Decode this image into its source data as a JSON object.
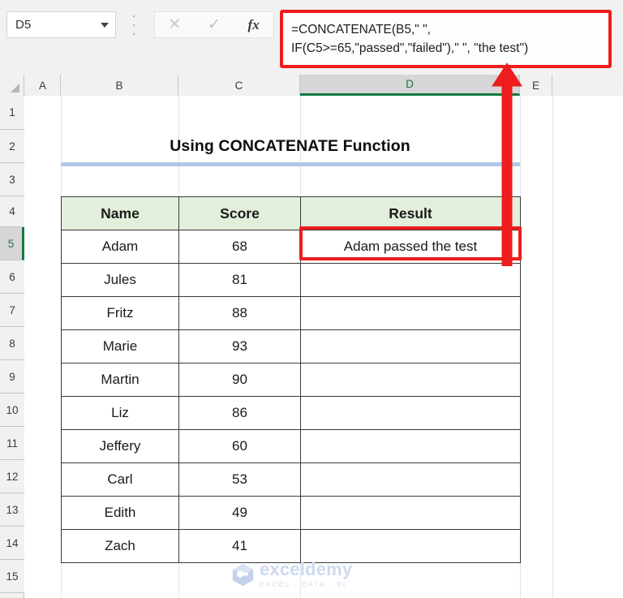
{
  "formula_bar": {
    "name_box_value": "D5",
    "cancel_icon": "close-x-icon",
    "enter_icon": "checkmark-icon",
    "insert_function_icon": "fx-icon",
    "formula_line1": "=CONCATENATE(B5,\" \",",
    "formula_line2": "IF(C5>=65,\"passed\",\"failed\"),\" \", \"the test\")",
    "highlight_color": "#ee1c1c"
  },
  "grid": {
    "column_headers": [
      "A",
      "B",
      "C",
      "D",
      "E"
    ],
    "active_column": "D",
    "row_headers": [
      "1",
      "2",
      "3",
      "4",
      "5",
      "6",
      "7",
      "8",
      "9",
      "10",
      "11",
      "12",
      "13",
      "14",
      "15"
    ],
    "active_row": "5",
    "active_cell": "D5",
    "active_color": "#107c41"
  },
  "report": {
    "title": "Using CONCATENATE Function",
    "title_rule_color": "#b0c7e8",
    "header_fill": "#e2efda",
    "table": {
      "columns": [
        "Name",
        "Score",
        "Result"
      ],
      "rows": [
        {
          "name": "Adam",
          "score": "68",
          "result": "Adam passed the test"
        },
        {
          "name": "Jules",
          "score": "81",
          "result": ""
        },
        {
          "name": "Fritz",
          "score": "88",
          "result": ""
        },
        {
          "name": "Marie",
          "score": "93",
          "result": ""
        },
        {
          "name": "Martin",
          "score": "90",
          "result": ""
        },
        {
          "name": "Liz",
          "score": "86",
          "result": ""
        },
        {
          "name": "Jeffery",
          "score": "60",
          "result": ""
        },
        {
          "name": "Carl",
          "score": "53",
          "result": ""
        },
        {
          "name": "Edith",
          "score": "49",
          "result": ""
        },
        {
          "name": "Zach",
          "score": "41",
          "result": ""
        }
      ]
    }
  },
  "annotation": {
    "arrow_icon": "up-arrow-annotation",
    "arrow_color": "#ee1c1c",
    "callout_target": "D5"
  },
  "watermark": {
    "brand": "exceldemy",
    "tagline": "EXCEL - DATA - BI",
    "color": "#cdd9ef"
  }
}
